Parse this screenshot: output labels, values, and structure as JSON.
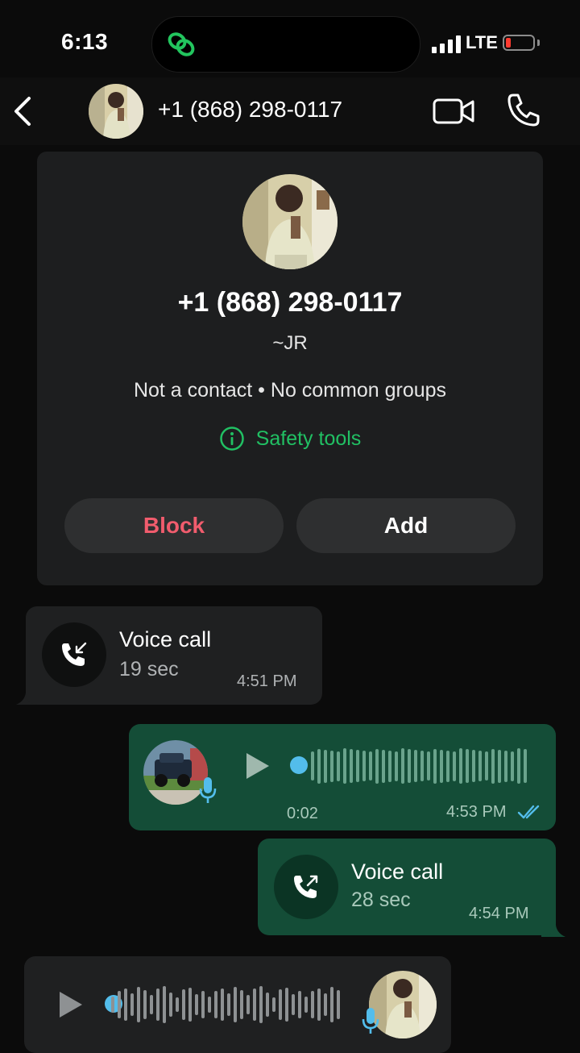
{
  "status_bar": {
    "time": "6:13",
    "network": "LTE",
    "battery_level": 0.15,
    "battery_color": "#ff3b30",
    "dynamic_island_icon": "link-rings-icon",
    "dynamic_island_icon_color": "#22c55e"
  },
  "header": {
    "back_icon": "chevron-left-icon",
    "title": "+1 (868) 298-0117",
    "video_icon": "video-camera-icon",
    "call_icon": "phone-icon"
  },
  "profile_card": {
    "phone": "+1 (868) 298-0117",
    "name": "~JR",
    "meta": "Not a contact • No common groups",
    "safety_label": "Safety tools",
    "block_label": "Block",
    "add_label": "Add",
    "block_color": "#f15c6d",
    "safety_color": "#21c063"
  },
  "messages": [
    {
      "type": "call",
      "direction": "incoming",
      "title": "Voice call",
      "duration": "19 sec",
      "time": "4:51 PM",
      "icon": "incoming-call-icon"
    },
    {
      "type": "voice",
      "direction": "outgoing",
      "duration": "0:02",
      "time": "4:53 PM",
      "status": "read",
      "status_icon": "double-check-icon",
      "status_color": "#53bdeb"
    },
    {
      "type": "call",
      "direction": "outgoing",
      "title": "Voice call",
      "duration": "28 sec",
      "time": "4:54 PM",
      "icon": "outgoing-call-icon"
    },
    {
      "type": "voice",
      "direction": "incoming"
    }
  ],
  "colors": {
    "background": "#0b0b0b",
    "incoming_bubble": "#1f2021",
    "outgoing_bubble": "#144d37",
    "accent_blue": "#53bdeb"
  }
}
